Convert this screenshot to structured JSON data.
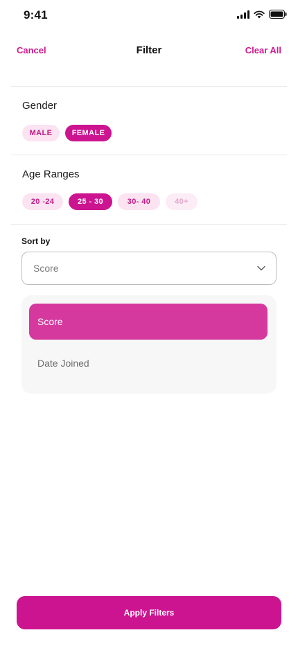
{
  "status_bar": {
    "time": "9:41",
    "icons": [
      "signal-icon",
      "wifi-icon",
      "battery-icon"
    ]
  },
  "header": {
    "cancel_label": "Cancel",
    "title": "Filter",
    "clear_label": "Clear All"
  },
  "gender": {
    "title": "Gender",
    "options": [
      {
        "label": "MALE",
        "state": "off"
      },
      {
        "label": "FEMALE",
        "state": "on"
      }
    ]
  },
  "age": {
    "title": "Age Ranges",
    "options": [
      {
        "label": "20 -24",
        "state": "off"
      },
      {
        "label": "25 - 30",
        "state": "on"
      },
      {
        "label": "30- 40",
        "state": "off"
      },
      {
        "label": "40+",
        "state": "disabled"
      }
    ]
  },
  "sort": {
    "label": "Sort by",
    "selected": "Score",
    "options": [
      "Score",
      "Date Joined"
    ]
  },
  "apply_label": "Apply Filters",
  "colors": {
    "accent": "#cc1490",
    "accent_light": "#fbe3f1",
    "selected_option": "#d5399e"
  }
}
